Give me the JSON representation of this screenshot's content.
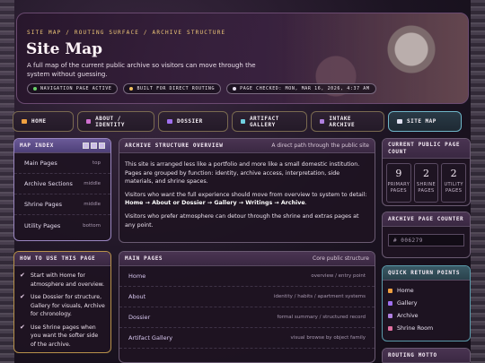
{
  "hero": {
    "breadcrumb": "SITE MAP / ROUTING SURFACE / ARCHIVE STRUCTURE",
    "title": "Site Map",
    "description": "A full map of the current public archive so visitors can move through the system without guessing.",
    "chips": [
      {
        "label": "NAVIGATION PAGE ACTIVE",
        "color": "#6ad06a"
      },
      {
        "label": "BUILT FOR DIRECT ROUTING",
        "color": "#f0c060"
      },
      {
        "label": "PAGE CHECKED: MON, MAR 16, 2026, 4:37 AM",
        "color": "#e8e0f0"
      }
    ]
  },
  "nav": {
    "items": [
      {
        "label": "HOME",
        "icon": "home-icon",
        "color": "#f0a040"
      },
      {
        "label": "ABOUT / IDENTITY",
        "icon": "identity-icon",
        "color": "#d070d0"
      },
      {
        "label": "DOSSIER",
        "icon": "folder-icon",
        "color": "#a070f0"
      },
      {
        "label": "ARTIFACT GALLERY",
        "icon": "gallery-icon",
        "color": "#70d0e0"
      },
      {
        "label": "INTAKE ARCHIVE",
        "icon": "archive-icon",
        "color": "#b080e0"
      },
      {
        "label": "SITE MAP",
        "icon": "map-icon",
        "color": "#e0e0f0"
      }
    ]
  },
  "map_index": {
    "title": "MAP INDEX",
    "rows": [
      {
        "name": "Main Pages",
        "tag": "top"
      },
      {
        "name": "Archive Sections",
        "tag": "middle"
      },
      {
        "name": "Shrine Pages",
        "tag": "middle"
      },
      {
        "name": "Utility Pages",
        "tag": "bottom"
      }
    ]
  },
  "howto": {
    "title": "HOW TO USE THIS PAGE",
    "items": [
      "Start with Home for atmosphere and overview.",
      "Use Dossier for structure, Gallery for visuals, Archive for chronology.",
      "Use Shrine pages when you want the softer side of the archive."
    ]
  },
  "overview": {
    "title": "ARCHIVE STRUCTURE OVERVIEW",
    "subtitle": "A direct path through the public site",
    "p1": "This site is arranged less like a portfolio and more like a small domestic institution. Pages are grouped by function: identity, archive access, interpretation, side materials, and shrine spaces.",
    "p2_lead": "Visitors who want the full experience should move from overview to system to detail:",
    "p2_path": "Home → About or Dossier → Gallery → Writings → Archive",
    "p2_end": ".",
    "p3": "Visitors who prefer atmosphere can detour through the shrine and extras pages at any point."
  },
  "main_pages": {
    "title": "MAIN PAGES",
    "subtitle": "Core public structure",
    "rows": [
      {
        "name": "Home",
        "desc": "overview / entry point"
      },
      {
        "name": "About",
        "desc": "identity / habits / apartment systems"
      },
      {
        "name": "Dossier",
        "desc": "formal summary / structured record"
      },
      {
        "name": "Artifact Gallery",
        "desc": "visual browse by object family"
      },
      {
        "name": "",
        "desc": ""
      }
    ]
  },
  "count": {
    "title": "CURRENT PUBLIC PAGE COUNT",
    "boxes": [
      {
        "num": "9",
        "label": "PRIMARY PAGES"
      },
      {
        "num": "2",
        "label": "SHRINE PAGES"
      },
      {
        "num": "2",
        "label": "UTILITY PAGES"
      }
    ]
  },
  "counter": {
    "title": "ARCHIVE PAGE COUNTER",
    "value": "# 006279"
  },
  "quick": {
    "title": "QUICK RETURN POINTS",
    "items": [
      {
        "label": "Home",
        "color": "#f0a040"
      },
      {
        "label": "Gallery",
        "color": "#a070f0"
      },
      {
        "label": "Archive",
        "color": "#b080e0"
      },
      {
        "label": "Shrine Room",
        "color": "#e070a0"
      }
    ]
  },
  "motto": {
    "title": "ROUTING MOTTO"
  }
}
